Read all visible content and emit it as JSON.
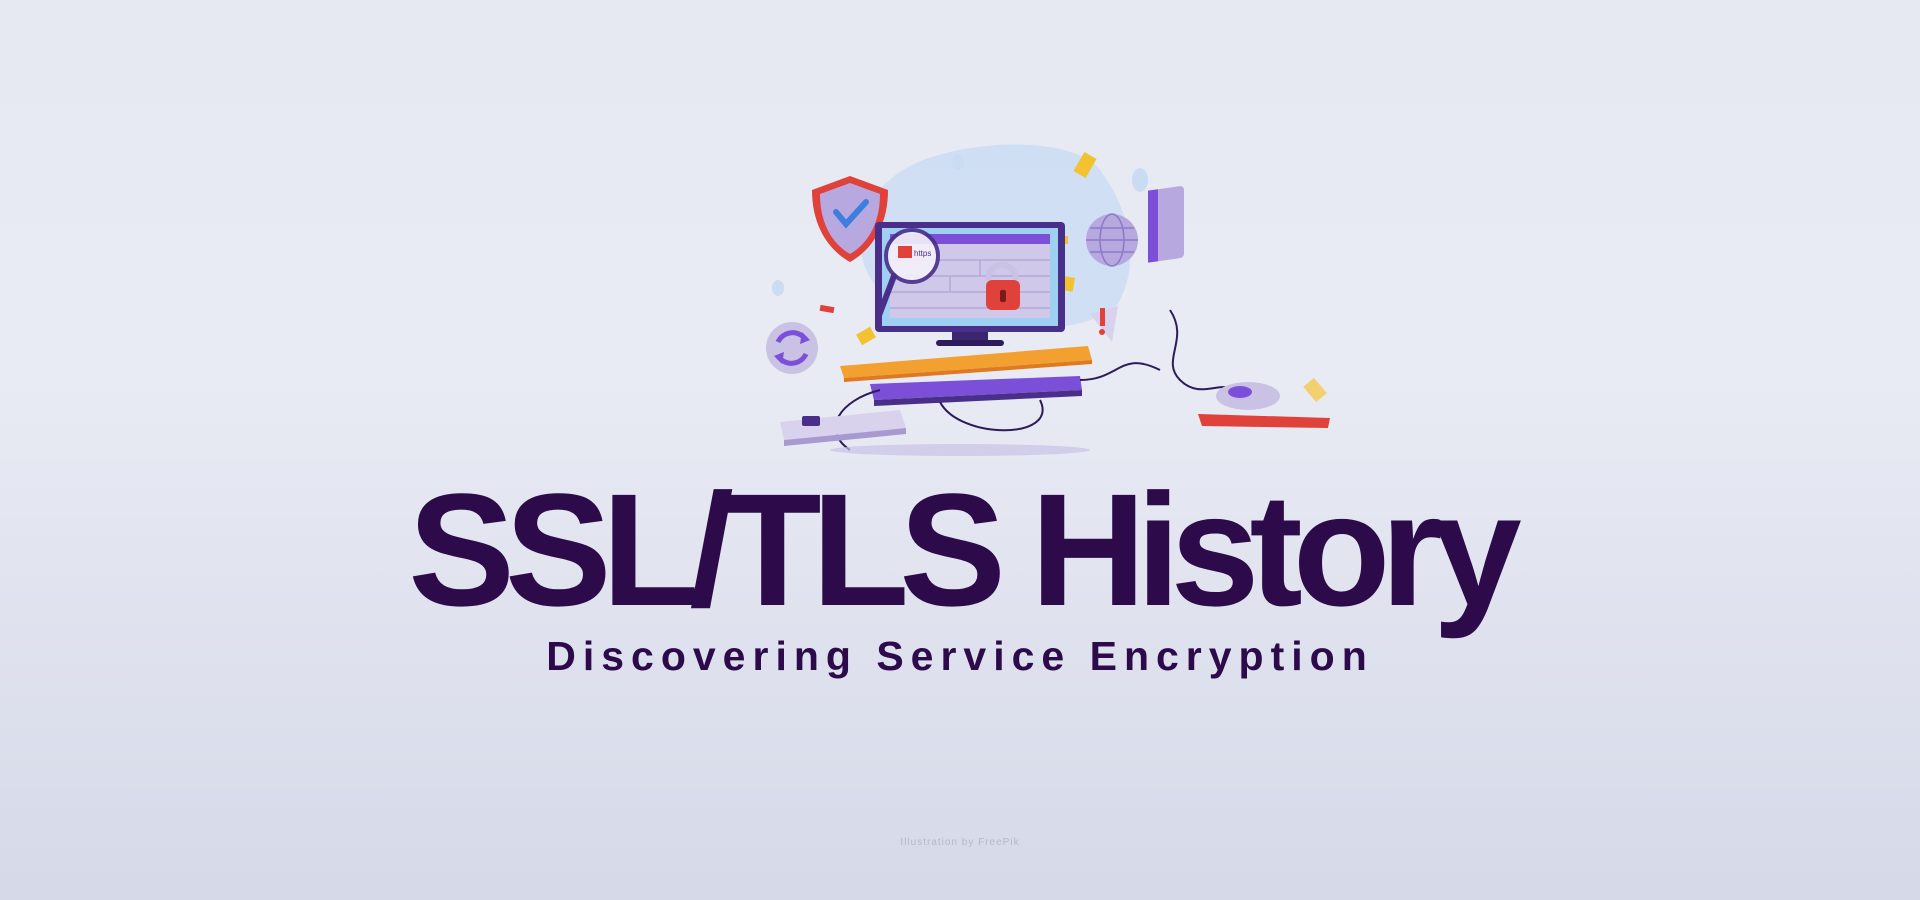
{
  "hero": {
    "title": "SSL/TLS History",
    "subtitle": "Discovering Service Encryption",
    "illustration": {
      "icons": [
        "shield-check-icon",
        "monitor-icon",
        "magnifier-icon",
        "padlock-icon",
        "globe-icon",
        "speaker-icon",
        "warning-icon",
        "sync-icon",
        "keyboard-icon",
        "mouse-icon",
        "power-strip-icon"
      ],
      "browser_badge": "https"
    }
  },
  "footer": {
    "credit": "Illustration by FreePik"
  },
  "colors": {
    "title": "#2d0b4a",
    "background": "#e6e8f2",
    "accent_purple": "#7b4fd8",
    "accent_red": "#e0413a",
    "accent_yellow": "#f2c230",
    "accent_blue": "#6fb6f0"
  }
}
